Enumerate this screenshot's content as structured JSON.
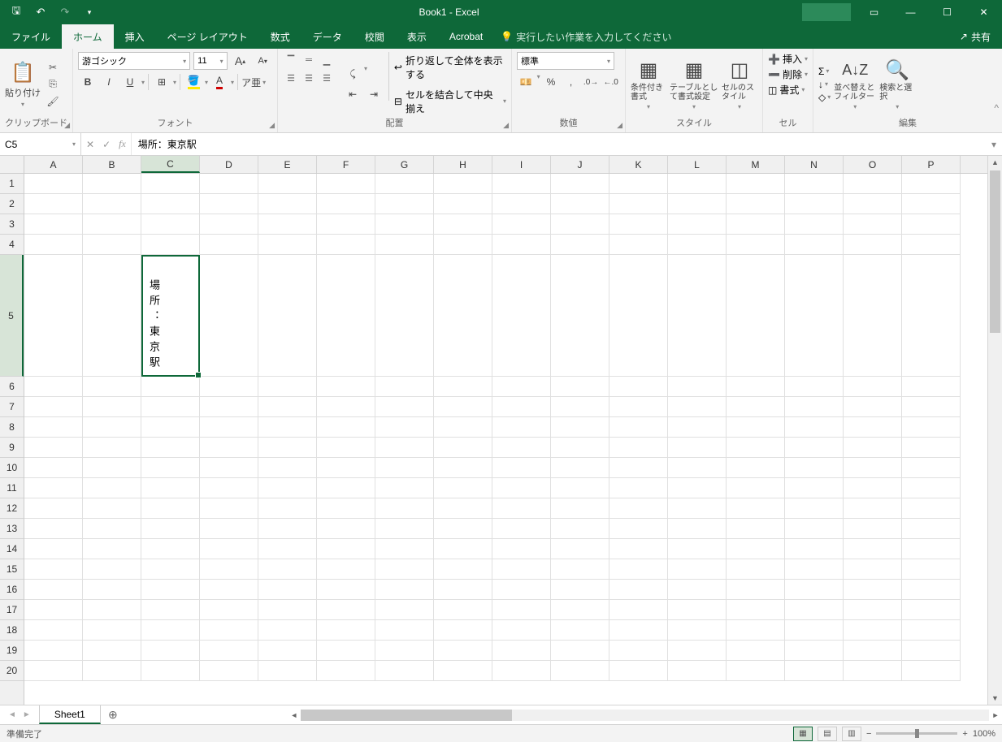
{
  "title": "Book1 - Excel",
  "qat": {
    "save": "💾",
    "undo": "↶",
    "redo": "↷",
    "more": "▾"
  },
  "tabs": [
    "ファイル",
    "ホーム",
    "挿入",
    "ページ レイアウト",
    "数式",
    "データ",
    "校閲",
    "表示",
    "Acrobat"
  ],
  "activeTab": "ホーム",
  "tellMe": "実行したい作業を入力してください",
  "share": "共有",
  "ribbon": {
    "clipboard": {
      "label": "クリップボード",
      "paste": "貼り付け"
    },
    "font": {
      "label": "フォント",
      "name": "游ゴシック",
      "size": "11",
      "bold": "B",
      "italic": "I",
      "underline": "U",
      "increase": "A",
      "decrease": "A"
    },
    "alignment": {
      "label": "配置",
      "wrap": "折り返して全体を表示する",
      "merge": "セルを結合して中央揃え"
    },
    "number": {
      "label": "数値",
      "format": "標準"
    },
    "styles": {
      "label": "スタイル",
      "cond": "条件付き書式",
      "table": "テーブルとして書式設定",
      "cell": "セルのスタイル"
    },
    "cells": {
      "label": "セル",
      "insert": "挿入",
      "delete": "削除",
      "format": "書式"
    },
    "editing": {
      "label": "編集",
      "sort": "並べ替えとフィルター",
      "find": "検索と選択"
    }
  },
  "nameBox": "C5",
  "formula": "場所：東京駅",
  "columns": [
    "A",
    "B",
    "C",
    "D",
    "E",
    "F",
    "G",
    "H",
    "I",
    "J",
    "K",
    "L",
    "M",
    "N",
    "O",
    "P"
  ],
  "rows": [
    1,
    2,
    3,
    4,
    5,
    6,
    7,
    8,
    9,
    10,
    11,
    12,
    13,
    14,
    15,
    16,
    17,
    18,
    19,
    20
  ],
  "activeCell": {
    "row": 5,
    "col": "C",
    "value": "場所：東京駅"
  },
  "sheetTab": "Sheet1",
  "status": "準備完了",
  "zoom": "100%"
}
